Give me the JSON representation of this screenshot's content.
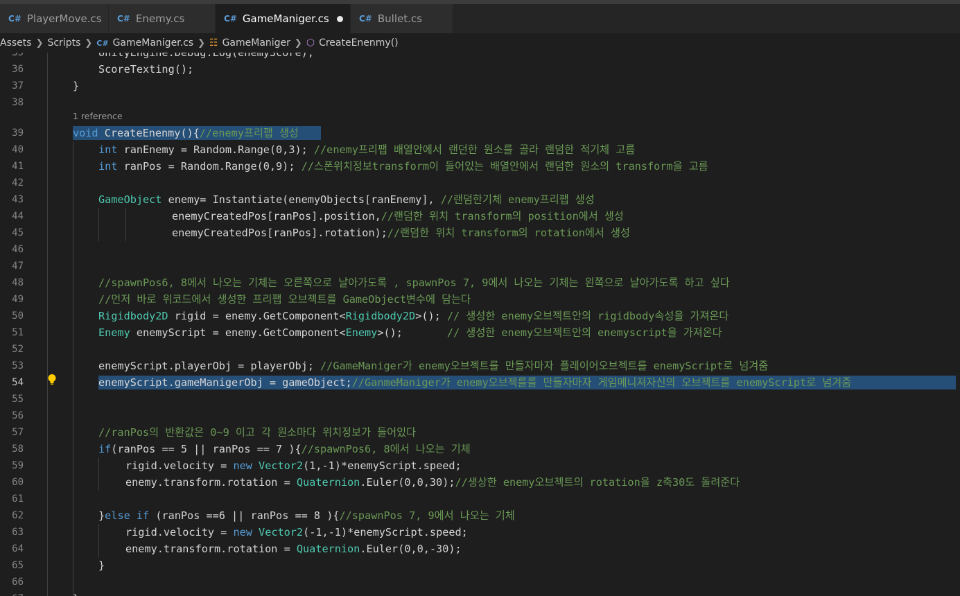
{
  "tabs": [
    {
      "label": "PlayerMove.cs",
      "icon": "csharp-file-icon",
      "width": 157,
      "active": false
    },
    {
      "label": "Enemy.cs",
      "icon": "csharp-file-icon",
      "width": 154,
      "active": false
    },
    {
      "label": "GameManiger.cs",
      "icon": "csharp-file-icon",
      "width": 195,
      "active": true,
      "modified": true
    },
    {
      "label": "Bullet.cs",
      "icon": "csharp-file-icon",
      "width": 148,
      "active": false
    }
  ],
  "breadcrumb": {
    "assets": "Assets",
    "scripts": "Scripts",
    "file": "GameManiger.cs",
    "class": "GameManiger",
    "method": "CreateEnenmy()"
  },
  "codelens": "1 reference",
  "current_line": "54",
  "lines": [
    {
      "n": "35",
      "tokens": [
        {
          "t": "UnityEngine.Debug.Log(enemyScore);",
          "c": "tx"
        }
      ]
    },
    {
      "n": "36",
      "tokens": [
        {
          "t": "ScoreTexting();",
          "c": "tx"
        }
      ]
    },
    {
      "n": "37",
      "tokens": [
        {
          "t": "}",
          "c": "tx"
        }
      ]
    },
    {
      "n": "38",
      "tokens": []
    },
    {
      "n": "39",
      "tokens": [
        {
          "t": "void",
          "c": "kw"
        },
        {
          "t": " CreateEnenmy(){",
          "c": "tx"
        },
        {
          "t": "//enemy프리팹 생성",
          "c": "cm"
        }
      ]
    },
    {
      "n": "40",
      "tokens": [
        {
          "t": "int",
          "c": "kw"
        },
        {
          "t": " ranEnemy = Random.Range(0,3); ",
          "c": "tx"
        },
        {
          "t": "//enemy프리팹 배열안에서 랜던한 원소를 골라 랜덤한 적기체 고름",
          "c": "cm"
        }
      ]
    },
    {
      "n": "41",
      "tokens": [
        {
          "t": "int",
          "c": "kw"
        },
        {
          "t": " ranPos = Random.Range(0,9); ",
          "c": "tx"
        },
        {
          "t": "//스폰위치정보transform이 들어있는 배열안에서 랜덤한 원소의 transform을 고름",
          "c": "cm"
        }
      ]
    },
    {
      "n": "42",
      "tokens": []
    },
    {
      "n": "43",
      "tokens": [
        {
          "t": "GameObject",
          "c": "ty"
        },
        {
          "t": " enemy= Instantiate(enemyObjects[ranEnemy], ",
          "c": "tx"
        },
        {
          "t": "//랜덤한기체 enemy프리팹 생성",
          "c": "cm"
        }
      ]
    },
    {
      "n": "44",
      "tokens": [
        {
          "t": "enemyCreatedPos[ranPos].position,",
          "c": "tx"
        },
        {
          "t": "//랜덤한 위치 transform의 position에서 생성",
          "c": "cm"
        }
      ]
    },
    {
      "n": "45",
      "tokens": [
        {
          "t": "enemyCreatedPos[ranPos].rotation);",
          "c": "tx"
        },
        {
          "t": "//랜덤한 위치 transform의 rotation에서 생성",
          "c": "cm"
        }
      ]
    },
    {
      "n": "46",
      "tokens": []
    },
    {
      "n": "47",
      "tokens": []
    },
    {
      "n": "48",
      "tokens": [
        {
          "t": "//spawnPos6, 8에서 나오는 기체는 오른쪽으로 날아가도록 , spawnPos 7, 9에서 나오는 기체는 왼쪽으로 날아가도록 하고 싶다",
          "c": "cm"
        }
      ]
    },
    {
      "n": "49",
      "tokens": [
        {
          "t": "//먼저 바로 위코드에서 생성한 프리팹 오브젝트를 GameObject변수에 담는다",
          "c": "cm"
        }
      ]
    },
    {
      "n": "50",
      "tokens": [
        {
          "t": "Rigidbody2D",
          "c": "ty"
        },
        {
          "t": " rigid = enemy.GetComponent<",
          "c": "tx"
        },
        {
          "t": "Rigidbody2D",
          "c": "ty"
        },
        {
          "t": ">(); ",
          "c": "tx"
        },
        {
          "t": "// 생성한 enemy오브젝트안의 rigidbody속성을 가져온다",
          "c": "cm"
        }
      ]
    },
    {
      "n": "51",
      "tokens": [
        {
          "t": "Enemy",
          "c": "ty"
        },
        {
          "t": " enemyScript = enemy.GetComponent<",
          "c": "tx"
        },
        {
          "t": "Enemy",
          "c": "ty"
        },
        {
          "t": ">();       ",
          "c": "tx"
        },
        {
          "t": "// 생성한 enemy오브젝트안의 enemyscript을 가져온다",
          "c": "cm"
        }
      ]
    },
    {
      "n": "52",
      "tokens": []
    },
    {
      "n": "53",
      "tokens": [
        {
          "t": "enemyScript.playerObj = playerObj; ",
          "c": "tx"
        },
        {
          "t": "//GameManiger가 enemy오브젝트를 만들자마자 플레이어오브젝트를 enemyScript로 넘겨줌",
          "c": "cm"
        }
      ]
    },
    {
      "n": "54",
      "tokens": [
        {
          "t": "enemyScript.gameManigerObj = gameObject;",
          "c": "tx"
        },
        {
          "t": "//GanmeManiger가 enemy오브젝를를 만들자마자 게임메니져자신의 오브젝트를 enemyScript로 넘겨줌",
          "c": "cm"
        }
      ]
    },
    {
      "n": "55",
      "tokens": []
    },
    {
      "n": "56",
      "tokens": []
    },
    {
      "n": "57",
      "tokens": [
        {
          "t": "//ranPos의 반환값은 0~9 이고 각 원소마다 위치정보가 들어있다",
          "c": "cm"
        }
      ]
    },
    {
      "n": "58",
      "tokens": [
        {
          "t": "if",
          "c": "kw"
        },
        {
          "t": "(ranPos == 5 || ranPos == 7 ){",
          "c": "tx"
        },
        {
          "t": "//spawnPos6, 8에서 나오는 기체",
          "c": "cm"
        }
      ]
    },
    {
      "n": "59",
      "tokens": [
        {
          "t": "rigid.velocity = ",
          "c": "tx"
        },
        {
          "t": "new",
          "c": "kw"
        },
        {
          "t": " ",
          "c": "tx"
        },
        {
          "t": "Vector2",
          "c": "ty"
        },
        {
          "t": "(1,-1)*enemyScript.speed;",
          "c": "tx"
        }
      ]
    },
    {
      "n": "60",
      "tokens": [
        {
          "t": "enemy.transform.rotation = ",
          "c": "tx"
        },
        {
          "t": "Quaternion",
          "c": "ty"
        },
        {
          "t": ".Euler(0,0,30);",
          "c": "tx"
        },
        {
          "t": "//생상한 enemy오브젝트의 rotation을 z축30도 돌려준다",
          "c": "cm"
        }
      ]
    },
    {
      "n": "61",
      "tokens": []
    },
    {
      "n": "62",
      "tokens": [
        {
          "t": "}",
          "c": "tx"
        },
        {
          "t": "else",
          "c": "kw"
        },
        {
          "t": " ",
          "c": "tx"
        },
        {
          "t": "if",
          "c": "kw"
        },
        {
          "t": " (ranPos ==6 || ranPos == 8 ){",
          "c": "tx"
        },
        {
          "t": "//spawnPos 7, 9에서 나오는 기체",
          "c": "cm"
        }
      ]
    },
    {
      "n": "63",
      "tokens": [
        {
          "t": "rigid.velocity = ",
          "c": "tx"
        },
        {
          "t": "new",
          "c": "kw"
        },
        {
          "t": " ",
          "c": "tx"
        },
        {
          "t": "Vector2",
          "c": "ty"
        },
        {
          "t": "(-1,-1)*enemyScript.speed;",
          "c": "tx"
        }
      ]
    },
    {
      "n": "64",
      "tokens": [
        {
          "t": "enemy.transform.rotation = ",
          "c": "tx"
        },
        {
          "t": "Quaternion",
          "c": "ty"
        },
        {
          "t": ".Euler(0,0,-30);",
          "c": "tx"
        }
      ]
    },
    {
      "n": "65",
      "tokens": [
        {
          "t": "}",
          "c": "tx"
        }
      ]
    },
    {
      "n": "66",
      "tokens": []
    },
    {
      "n": "67",
      "tokens": [
        {
          "t": "}",
          "c": "tx"
        }
      ]
    }
  ],
  "colors": {
    "keyword": "#569cd6",
    "type": "#4ec9b0",
    "comment": "#6a9955",
    "text": "#d4d4d4",
    "selection": "#264f78",
    "bulb": "#ffcc00"
  }
}
